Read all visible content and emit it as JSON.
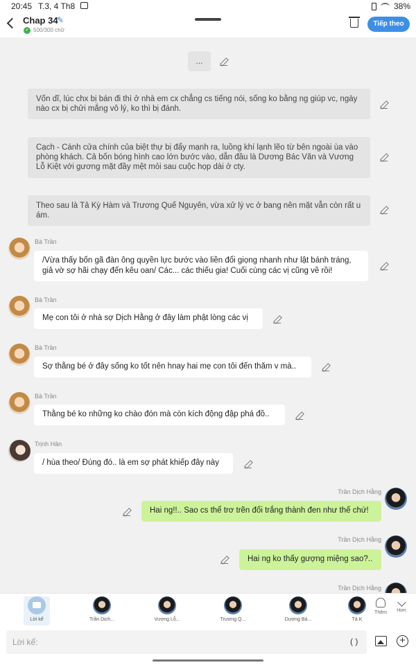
{
  "status": {
    "time": "20:45",
    "date": "T.3, 4 Th8",
    "battery": "38%"
  },
  "header": {
    "title": "Chap 34",
    "count": "500/300 chữ",
    "follow_label": "Tiếp theo"
  },
  "placeholder_block": "...",
  "narrations": [
    "Vốn dĩ, lúc chx bị bán đi thì ở nhà em cx chẳng cs tiếng nói, sống ko bằng ng giúp vc, ngày nào cx bị chửi mắng vô lý, ko thì bị đánh.",
    "Cạch - Cánh cửa chính của biệt thự bị đẩy mạnh ra, luồng khí lạnh lẽo từ bên ngoài ùa vào phòng khách. Cả bốn bóng hình cao lớn bước vào, dẫn đầu là Dương Bác Văn và Vương Lỗ Kiệt với gương mặt đầy mệt mỏi sau cuộc họp dài ở cty.",
    "Theo sau là Tả Kỳ Hàm và Trương Quế Nguyên, vừa xử lý vc ở bang nên mặt vẫn còn rất u ám."
  ],
  "messages": [
    {
      "speaker": "Bà Trần",
      "text": "/Vừa thấy bốn gã đàn ông quyền lực bước vào liền đổi giọng nhanh như lật bánh tráng, giả vờ sợ hãi chạy đến kêu oan/ Các... các thiếu gia! Cuối cùng các vị cũng về rồi!"
    },
    {
      "speaker": "Bà Trần",
      "text": "Mẹ con tôi ở nhà sợ Dịch Hằng ở đây làm phật lòng các vị"
    },
    {
      "speaker": "Bà Trần",
      "text": "Sợ thằng bé ở đây sống ko tốt nên hnay hai mẹ con tôi đến thăm v mà.."
    },
    {
      "speaker": "Bà Trần",
      "text": "Thằng bé ko những ko chào đón mà còn kích động đập phá đồ.."
    },
    {
      "speaker": "Trịnh Hân",
      "text": "/ hùa theo/ Đúng đó.. là em sợ phát khiếp đây này"
    },
    {
      "speaker": "Trần Dịch Hằng",
      "text": "Hai ng!!.. Sao cs thể trơ trẽn đổi trắng thành đen như thế chứ!"
    },
    {
      "speaker": "Trần Dịch Hằng",
      "text": "Hai ng ko thấy gượng miệng sao?.."
    },
    {
      "speaker": "Trần Dịch Hằng",
      "text": ""
    }
  ],
  "characters": [
    {
      "label": "Lời kể"
    },
    {
      "label": "Trần Dịch..."
    },
    {
      "label": "Vương Lỗ..."
    },
    {
      "label": "Trương Q..."
    },
    {
      "label": "Dương Bá..."
    },
    {
      "label": "Tả K"
    }
  ],
  "side_buttons": {
    "add_label": "Thêm",
    "more_label": "Hơn"
  },
  "input": {
    "placeholder": "Lời kể:",
    "paren": "( )"
  }
}
